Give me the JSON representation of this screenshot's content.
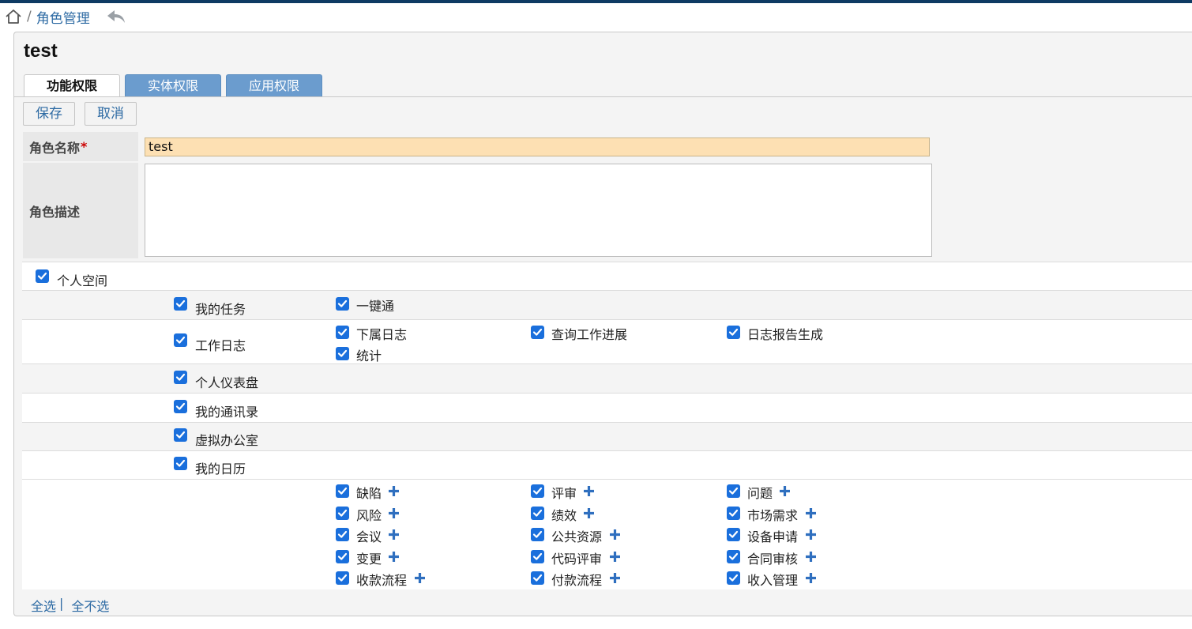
{
  "breadcrumb": {
    "separator": "/",
    "current": "角色管理"
  },
  "page_title": "test",
  "tabs": [
    {
      "label": "功能权限",
      "active": true
    },
    {
      "label": "实体权限",
      "active": false
    },
    {
      "label": "应用权限",
      "active": false
    }
  ],
  "buttons": {
    "save": "保存",
    "cancel": "取消"
  },
  "form": {
    "role_name_label": "角色名称",
    "required_mark": "*",
    "role_name_value": "test",
    "role_desc_label": "角色描述",
    "role_desc_value": ""
  },
  "permissions": {
    "root": {
      "label": "个人空间",
      "checked": true
    },
    "rows": [
      {
        "label": "我的任务",
        "checked": true,
        "children": [
          {
            "label": "一键通",
            "checked": true
          }
        ]
      },
      {
        "label": "工作日志",
        "checked": true,
        "children": [
          {
            "label": "下属日志",
            "checked": true
          },
          {
            "label": "查询工作进展",
            "checked": true
          },
          {
            "label": "日志报告生成",
            "checked": true
          },
          {
            "label": "统计",
            "checked": true
          }
        ]
      },
      {
        "label": "个人仪表盘",
        "checked": true,
        "children": []
      },
      {
        "label": "我的通讯录",
        "checked": true,
        "children": []
      },
      {
        "label": "虚拟办公室",
        "checked": true,
        "children": []
      },
      {
        "label": "我的日历",
        "checked": true,
        "children": []
      }
    ],
    "calendar_items": [
      {
        "label": "缺陷",
        "checked": true,
        "plus": true
      },
      {
        "label": "评审",
        "checked": true,
        "plus": true
      },
      {
        "label": "问题",
        "checked": true,
        "plus": true
      },
      {
        "label": "风险",
        "checked": true,
        "plus": true
      },
      {
        "label": "绩效",
        "checked": true,
        "plus": true
      },
      {
        "label": "市场需求",
        "checked": true,
        "plus": true
      },
      {
        "label": "会议",
        "checked": true,
        "plus": true
      },
      {
        "label": "公共资源",
        "checked": true,
        "plus": true
      },
      {
        "label": "设备申请",
        "checked": true,
        "plus": true
      },
      {
        "label": "变更",
        "checked": true,
        "plus": true
      },
      {
        "label": "代码评审",
        "checked": true,
        "plus": true
      },
      {
        "label": "合同审核",
        "checked": true,
        "plus": true
      },
      {
        "label": "收款流程",
        "checked": true,
        "plus": true
      },
      {
        "label": "付款流程",
        "checked": true,
        "plus": true
      },
      {
        "label": "收入管理",
        "checked": true,
        "plus": true
      }
    ]
  },
  "footer": {
    "select_all": "全选",
    "separator": "|",
    "select_none": "全不选"
  },
  "colors": {
    "accent": "#1a6fdc",
    "link": "#2d6aa3",
    "tab_inactive": "#6b9cce",
    "topbar": "#0e3a63",
    "name_input_bg": "#fde0b3"
  },
  "icons": {
    "home": "home-icon",
    "back": "back-arrow-icon",
    "check": "checkbox-check-icon",
    "plus": "plus-icon"
  }
}
